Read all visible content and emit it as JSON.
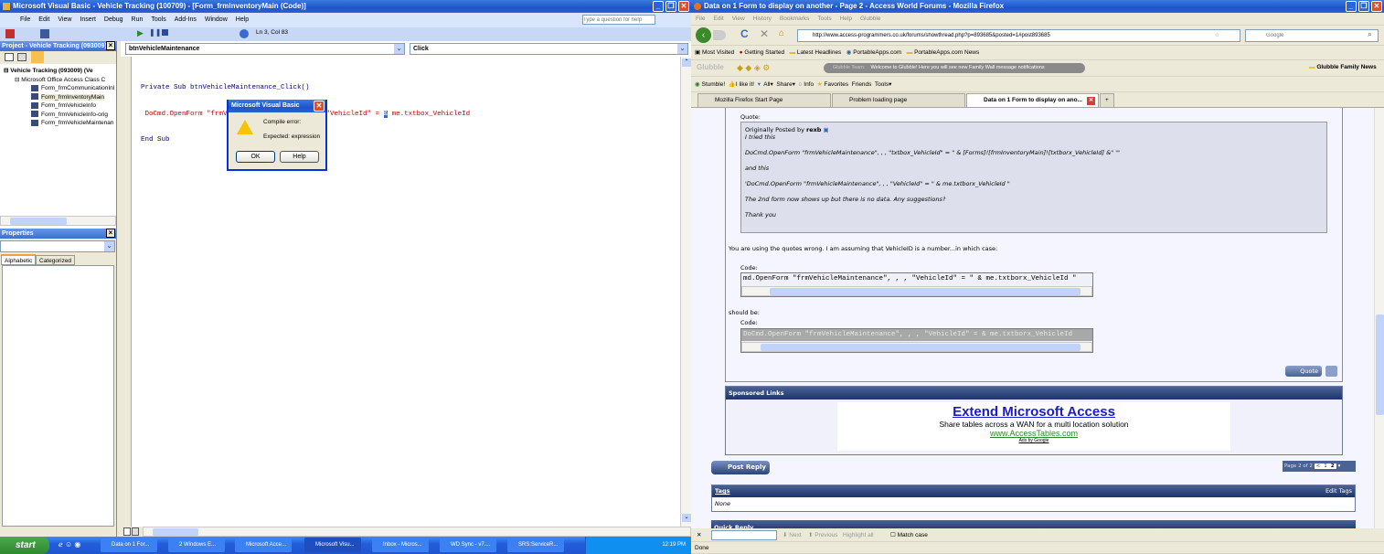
{
  "vb": {
    "title": "Microsoft Visual Basic - Vehicle Tracking (100709) - [Form_frmInventoryMain (Code)]",
    "menu": [
      "File",
      "Edit",
      "View",
      "Insert",
      "Debug",
      "Run",
      "Tools",
      "Add-Ins",
      "Window",
      "Help"
    ],
    "help_placeholder": "Type a question for help",
    "position": "Ln 3, Col 83",
    "project_title": "Project - Vehicle Tracking (093009)",
    "tree": {
      "root": "Vehicle Tracking (093009) (Ve",
      "folder": "Microsoft Office Access Class C",
      "items": [
        "Form_frmCommunicationInl",
        "Form_frmInventoryMain",
        "Form_frmVehicleInfo",
        "Form_frmVehicleInfo-orig",
        "Form_frmVehicleMaintenan"
      ]
    },
    "properties_title": "Properties",
    "prop_tabs": [
      "Alphabetic",
      "Categorized"
    ],
    "object_combo": "btnVehicleMaintenance",
    "proc_combo": "Click",
    "code": {
      "line1": "Private Sub btnVehicleMaintenance_Click()",
      "line2a": " DoCmd.OpenForm \"frmVehicleMaintenance\", , , \"VehicleId\" = ",
      "line2sel": "&",
      "line2b": " me.txtbox_VehicleId",
      "line3": "End Sub"
    },
    "dialog": {
      "title": "Microsoft Visual Basic",
      "line1": "Compile error:",
      "line2": "Expected: expression",
      "ok": "OK",
      "help": "Help"
    }
  },
  "taskbar": {
    "start": "start",
    "items": [
      "Data on 1 For...",
      "2 Windows E...",
      "Microsoft Acce...",
      "Microsoft Visu...",
      "Inbox - Micros...",
      "WD Sync - v7....",
      "SRS:ServiceR..."
    ],
    "clock": "12:19 PM"
  },
  "ff": {
    "title": "Data on 1 Form to display on another - Page 2 - Access World Forums - Mozilla Firefox",
    "menu": [
      "File",
      "Edit",
      "View",
      "History",
      "Bookmarks",
      "Tools",
      "Help",
      "Glubble"
    ],
    "url": "http://www.access-programmers.co.uk/forums/showthread.php?p=893685&posted=1#post893685",
    "search_placeholder": "Google",
    "bookmarks": [
      "Most Visited",
      "Getting Started",
      "Latest Headlines",
      "PortableApps.com",
      "PortableApps.com News"
    ],
    "glubble": {
      "logo": "Glubble",
      "team": "Glubble Team:",
      "message": "Welcome to Glubble! Here you will see new Family Wall message notifications",
      "news": "Glubble Family News"
    },
    "stumble": [
      "Stumble!",
      "I like it!",
      "All",
      "Share",
      "Info",
      "Favorites",
      "Friends",
      "Tools"
    ],
    "tabs": [
      "Mozilla Firefox Start Page",
      "Problem loading page",
      "Data on 1 Form to display on ano..."
    ],
    "post": {
      "quote_label": "Quote:",
      "orig_prefix": "Originally Posted by ",
      "orig_user": "rexb",
      "q": [
        "I tried this",
        "DoCmd.OpenForm \"frmVehicleMaintenance\", , , \"txtbox_VehicleId\" = \" & [Forms]![frmInventoryMain]![txtborx_VehicleId] &\" '\"",
        "and this",
        "'DoCmd.OpenForm \"frmVehicleMaintenance\", , , \"VehicleId\" = \" & me.txtborx_VehicleId \"",
        "The 2nd form now shows up but there is no data. Any suggestions?",
        "Thank you"
      ],
      "reply": "You are using the quotes wrong. I am assuming that VehicleID is a number...in which case:",
      "code_label": "Code:",
      "code1": "md.OpenForm \"frmVehicleMaintenance\", , , \"VehicleId\" = \" & me.txtborx_VehicleId \"",
      "should_be": "should be:",
      "code2": "DoCmd.OpenForm \"frmVehicleMaintenance\", , , \"VehicleId\" =  & me.txtborx_VehicleId",
      "quote_btn": "Quote"
    },
    "sponsored": {
      "header": "Sponsored Links",
      "title": "Extend Microsoft Access",
      "desc": "Share tables across a WAN for a multi location solution",
      "url": "www.AccessTables.com",
      "ads": "Ads by Google"
    },
    "post_reply": "Post Reply",
    "pager": {
      "label": "Page 2 of 2",
      "prev": "<",
      "p1": "1",
      "p2": "2"
    },
    "tags": {
      "header": "Tags",
      "edit": "Edit Tags",
      "value": "None"
    },
    "quick_reply": "Quick Reply",
    "find": {
      "next": "Next",
      "previous": "Previous",
      "highlight": "Highlight all",
      "match": "Match case"
    },
    "status": "Done"
  }
}
